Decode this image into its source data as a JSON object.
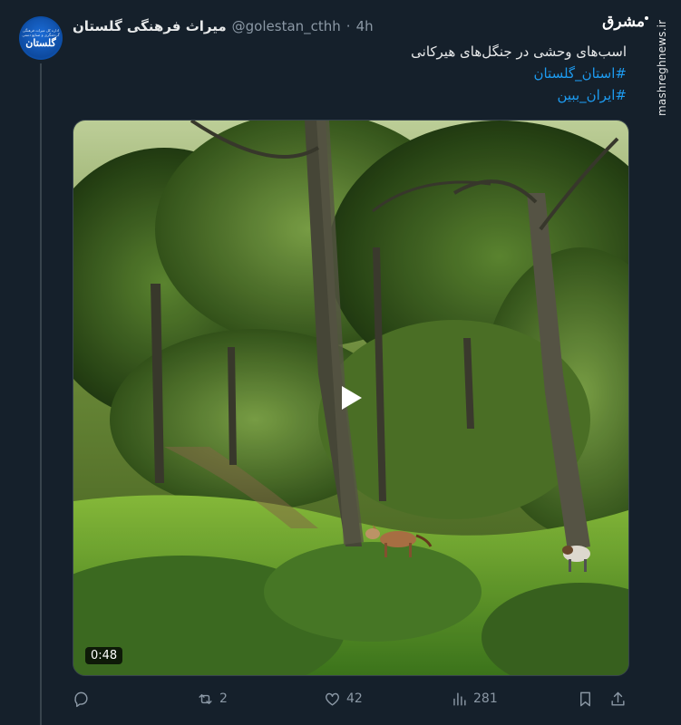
{
  "author": {
    "display_name": "میراث فرهنگی گلستان",
    "handle": "@golestan_cthh",
    "separator": "·",
    "time": "4h",
    "avatar": {
      "main_text": "گلستان",
      "sub_text_line1": "اداره کل میراث فرهنگی",
      "sub_text_line2": "گردشگری و صنایع دستی"
    }
  },
  "watermark": {
    "logo_text": "مشرق",
    "site_text": "mashreghnews.ir"
  },
  "tweet": {
    "text": "اسب‌های وحشی در جنگل‌های هیرکانی",
    "hashtags": [
      "#استان_گلستان",
      "#ایران_ببین"
    ]
  },
  "media": {
    "type": "video",
    "duration": "0:48",
    "play_icon": "play-icon",
    "scene": "forest-with-wild-horses"
  },
  "actions": {
    "reply": {
      "icon": "reply-icon",
      "count": ""
    },
    "retweet": {
      "icon": "retweet-icon",
      "count": "2"
    },
    "like": {
      "icon": "heart-icon",
      "count": "42"
    },
    "views": {
      "icon": "views-icon",
      "count": "281"
    },
    "bookmark": {
      "icon": "bookmark-icon"
    },
    "share": {
      "icon": "share-icon"
    }
  },
  "colors": {
    "background": "#15202b",
    "text": "#e7e9ea",
    "muted": "#8b98a5",
    "accent": "#1d9bf0",
    "border": "#38444d"
  }
}
